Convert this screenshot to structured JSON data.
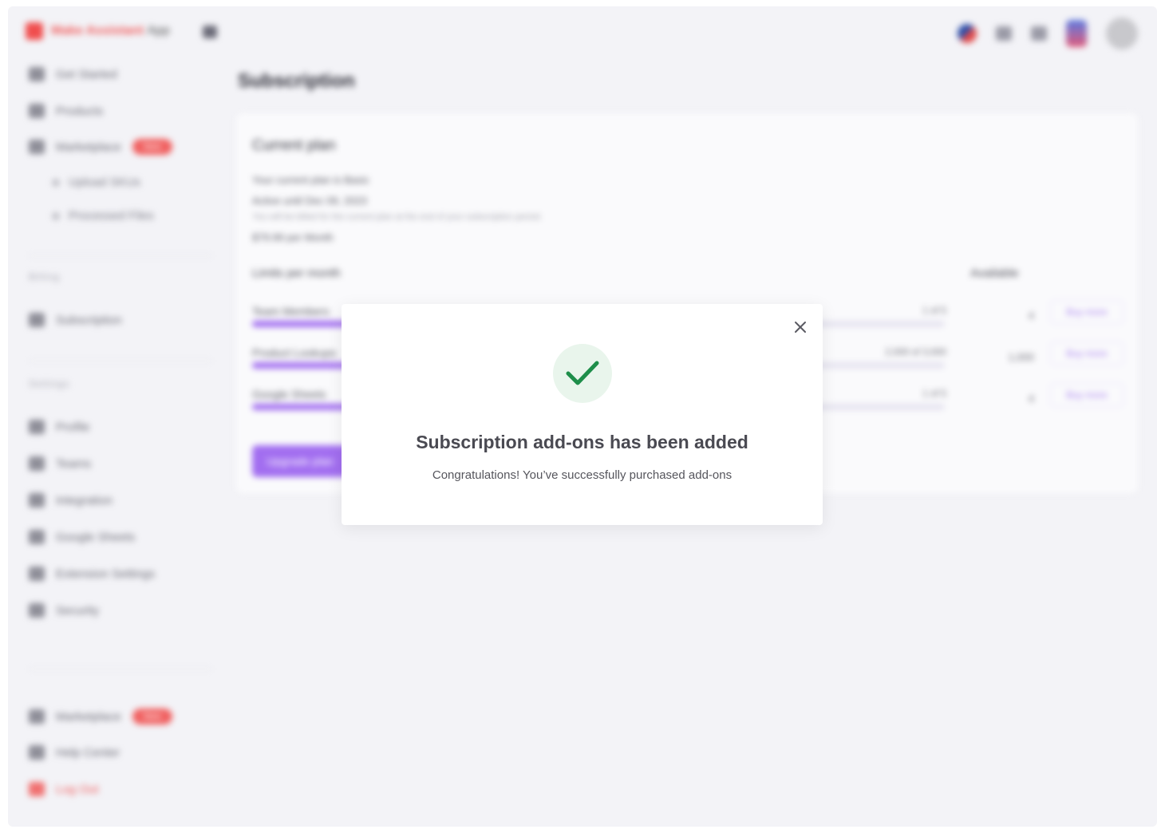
{
  "app": {
    "brand_name": "Make Assistant",
    "brand_suffix": "App"
  },
  "sidebar": {
    "items": [
      {
        "label": "Get Started",
        "icon": "rocket-icon"
      },
      {
        "label": "Products",
        "icon": "box-icon"
      },
      {
        "label": "Marketplace",
        "icon": "store-icon",
        "badge": "New"
      }
    ],
    "sub_items": [
      {
        "label": "Upload SKUs"
      },
      {
        "label": "Processed Files"
      }
    ],
    "section_billing": "Billing",
    "billing_items": [
      {
        "label": "Subscription",
        "icon": "card-icon"
      }
    ],
    "section_settings": "Settings",
    "settings_items": [
      {
        "label": "Profile",
        "icon": "user-icon"
      },
      {
        "label": "Teams",
        "icon": "team-icon"
      },
      {
        "label": "Integration",
        "icon": "plug-icon"
      },
      {
        "label": "Google Sheets",
        "icon": "sheet-icon"
      },
      {
        "label": "Extension Settings",
        "icon": "extension-icon"
      },
      {
        "label": "Security",
        "icon": "lock-icon"
      }
    ],
    "bottom_items": [
      {
        "label": "Marketplace",
        "icon": "store-icon",
        "badge": "New"
      },
      {
        "label": "Help Center",
        "icon": "help-icon"
      },
      {
        "label": "Log Out",
        "icon": "logout-icon"
      }
    ]
  },
  "main": {
    "page_title": "Subscription",
    "card_title": "Current plan",
    "plan_line_1": "Your current plan is Basic",
    "plan_line_2": "Active until Dec 09, 2023",
    "plan_note": "You will be billed for the current plan at the end of your subscription period.",
    "plan_line_3": "$79.99 per Month",
    "limits_title": "Limits per month",
    "available_title": "Available",
    "limits": [
      {
        "name": "Team Members",
        "value": "1 of 5",
        "fill": 0.2,
        "available": "4",
        "button": "Buy more"
      },
      {
        "name": "Product Lookups",
        "value": "2,000 of 3,000",
        "fill": 0.67,
        "available": "1,000",
        "button": "Buy more"
      },
      {
        "name": "Google Sheets",
        "value": "1 of 5",
        "fill": 0.2,
        "available": "4",
        "button": "Buy more"
      }
    ],
    "primary_button": "Upgrade plan"
  },
  "modal": {
    "title": "Subscription add-ons has been added",
    "message": "Congratulations! You’ve successfully purchased add-ons",
    "success_color": "#1e8e4a",
    "close_icon": "close-icon"
  }
}
